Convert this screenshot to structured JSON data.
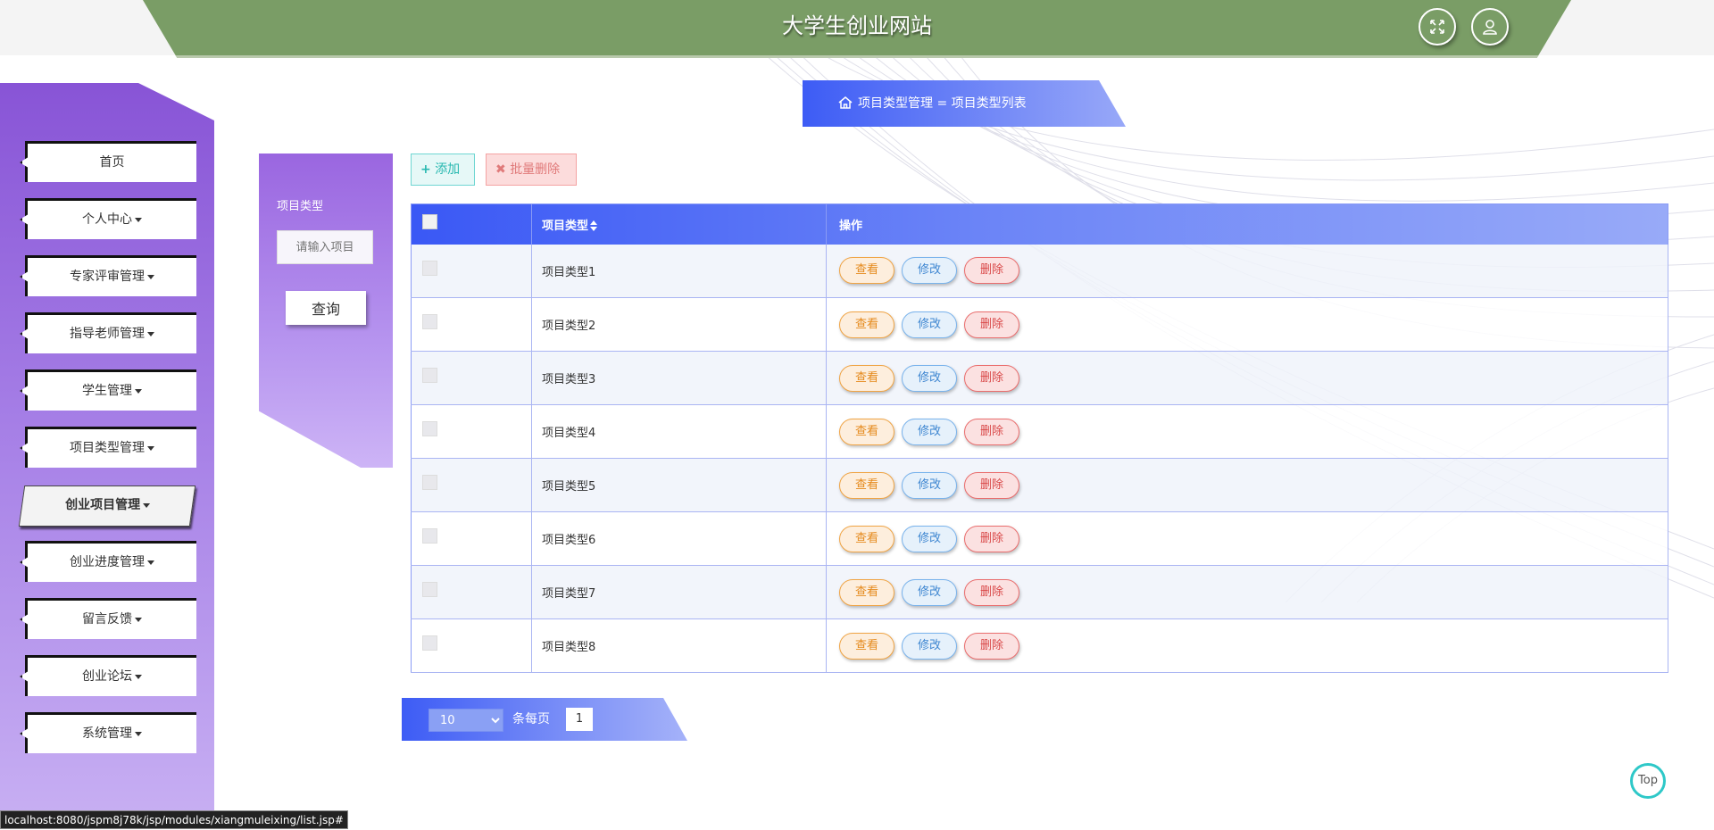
{
  "header": {
    "title": "大学生创业网站",
    "fullscreen_icon": "expand-icon",
    "user_icon": "user-icon"
  },
  "sidebar": {
    "items": [
      {
        "label": "首页",
        "has_dropdown": false
      },
      {
        "label": "个人中心",
        "has_dropdown": true
      },
      {
        "label": "专家评审管理",
        "has_dropdown": true
      },
      {
        "label": "指导老师管理",
        "has_dropdown": true
      },
      {
        "label": "学生管理",
        "has_dropdown": true
      },
      {
        "label": "项目类型管理",
        "has_dropdown": true
      },
      {
        "label": "创业项目管理",
        "has_dropdown": true,
        "active": true
      },
      {
        "label": "创业进度管理",
        "has_dropdown": true
      },
      {
        "label": "留言反馈",
        "has_dropdown": true
      },
      {
        "label": "创业论坛",
        "has_dropdown": true
      },
      {
        "label": "系统管理",
        "has_dropdown": true
      }
    ]
  },
  "breadcrumb": {
    "text": "项目类型管理 = 项目类型列表",
    "icon": "home-icon"
  },
  "search": {
    "label": "项目类型",
    "placeholder": "请输入项目",
    "button_label": "查询"
  },
  "toolbar": {
    "add_label": "添加",
    "batch_delete_label": "批量删除"
  },
  "table": {
    "columns": [
      "项目类型",
      "操作"
    ],
    "rows": [
      "项目类型1",
      "项目类型2",
      "项目类型3",
      "项目类型4",
      "项目类型5",
      "项目类型6",
      "项目类型7",
      "项目类型8"
    ],
    "actions": {
      "view": "查看",
      "edit": "修改",
      "delete": "删除"
    }
  },
  "pagination": {
    "page_size": "10",
    "per_page_label": "条每页",
    "current_page": "1"
  },
  "top_button": "Top",
  "status_url": "localhost:8080/jspm8j78k/jsp/modules/xiangmuleixing/list.jsp#",
  "colors": {
    "header": "#7a9d66",
    "sidebar_gradient": [
      "#8854d6",
      "#c8b0f3"
    ],
    "table_header": "#3a58f5",
    "view": "#e58a1d",
    "edit": "#3e86d1",
    "delete": "#d94848"
  }
}
